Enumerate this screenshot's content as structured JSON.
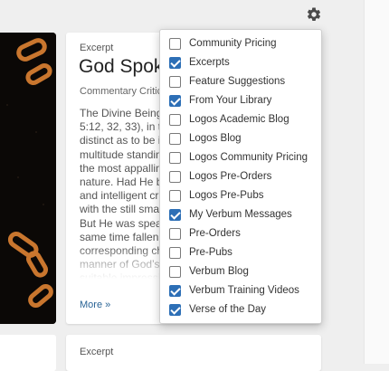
{
  "header": {
    "settings_icon": "gear-icon"
  },
  "card": {
    "label": "Excerpt",
    "title": "God Spoke",
    "subtitle": "Commentary Critical",
    "body": "The Divine Being\n5:12, 32, 33), in to\ndistinct as to be i\nmultitude standin\nthe most appallin\nnature. Had He b\nand intelligent cr\nwith the still sma\nBut He was speak\nsame time fallen\ncorresponding ch\nmanner of God’s\nsuitable impressi",
    "more": "More »"
  },
  "card2": {
    "label": "Excerpt"
  },
  "feed_filter": {
    "options": [
      {
        "label": "Community Pricing",
        "checked": false
      },
      {
        "label": "Excerpts",
        "checked": true
      },
      {
        "label": "Feature Suggestions",
        "checked": false
      },
      {
        "label": "From Your Library",
        "checked": true
      },
      {
        "label": "Logos Academic Blog",
        "checked": false
      },
      {
        "label": "Logos Blog",
        "checked": false
      },
      {
        "label": "Logos Community Pricing",
        "checked": false
      },
      {
        "label": "Logos Pre-Orders",
        "checked": false
      },
      {
        "label": "Logos Pre-Pubs",
        "checked": false
      },
      {
        "label": "My Verbum Messages",
        "checked": true
      },
      {
        "label": "Pre-Orders",
        "checked": false
      },
      {
        "label": "Pre-Pubs",
        "checked": false
      },
      {
        "label": "Verbum Blog",
        "checked": false
      },
      {
        "label": "Verbum Training Videos",
        "checked": true
      },
      {
        "label": "Verse of the Day",
        "checked": true
      }
    ]
  }
}
